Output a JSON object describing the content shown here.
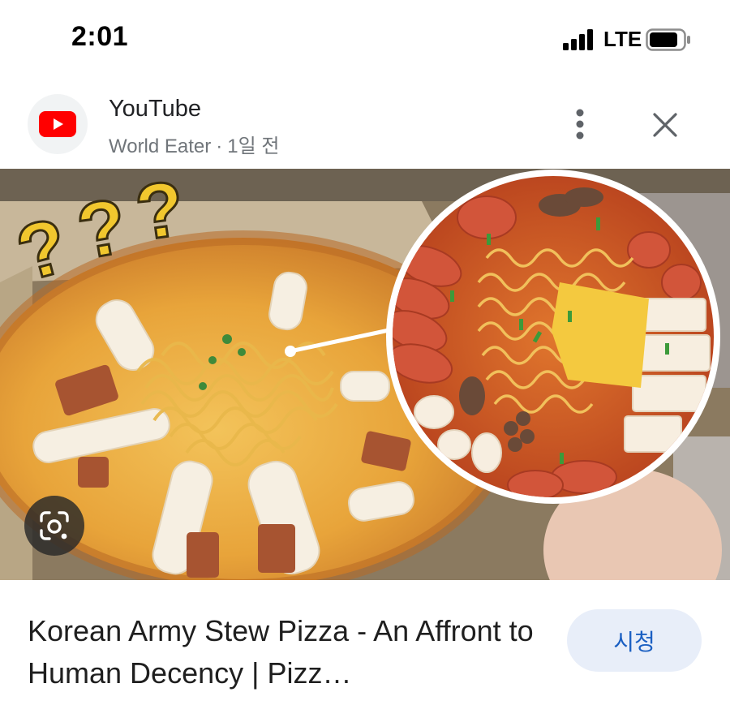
{
  "status_bar": {
    "time": "2:01",
    "network": "LTE",
    "icons": [
      "signal-icon",
      "battery-icon"
    ]
  },
  "source": {
    "app_name": "YouTube",
    "channel": "World Eater",
    "separator": "·",
    "age": "1일 전",
    "logo_icon": "youtube-logo-icon",
    "brand_color": "#ff0000"
  },
  "actions": {
    "more_icon": "more-vert-icon",
    "close_icon": "close-icon"
  },
  "thumbnail": {
    "overlay_text": [
      "?",
      "?",
      "?"
    ],
    "lens_icon": "google-lens-icon"
  },
  "video": {
    "title": "Korean Army Stew Pizza - An Affront to Human Decency | Pizz…",
    "watch_label": "시청",
    "watch_color": "#1a5fc2"
  }
}
